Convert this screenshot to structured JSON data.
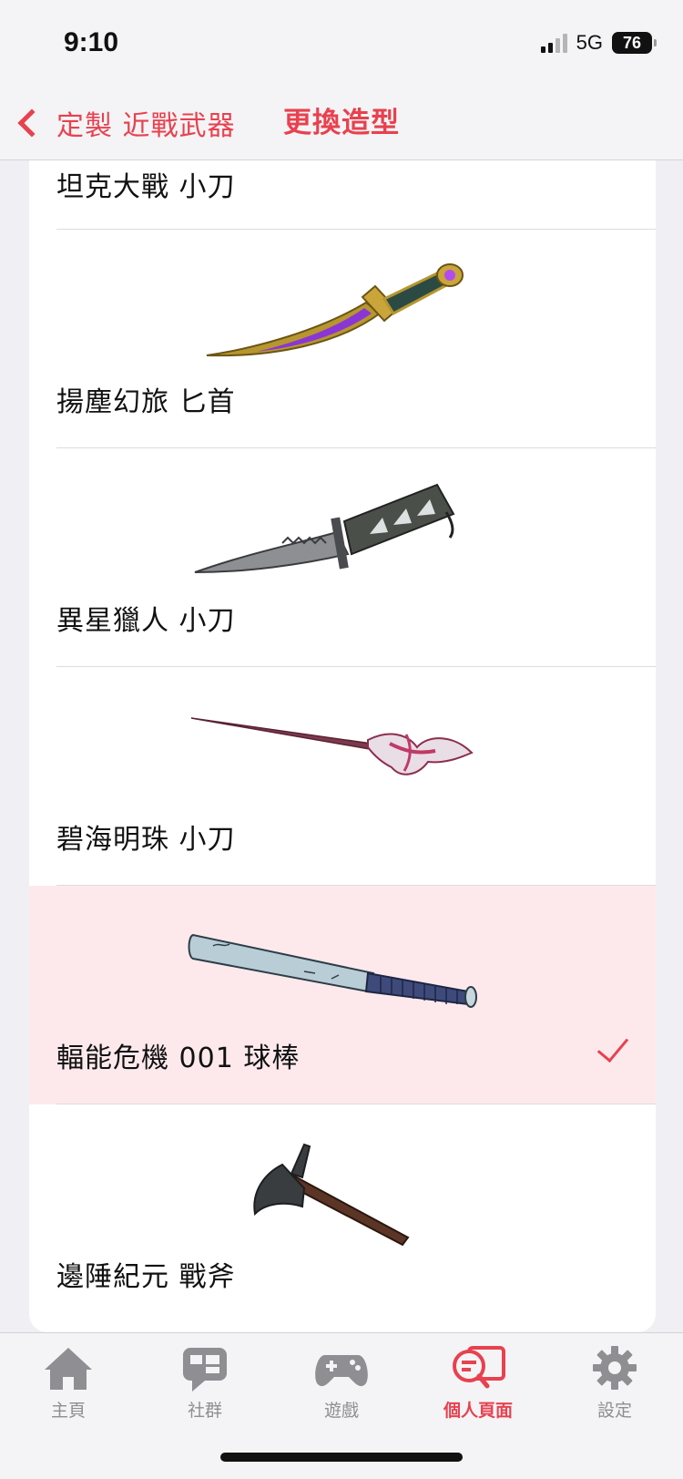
{
  "status_bar": {
    "time": "9:10",
    "network": "5G",
    "battery": "76"
  },
  "nav": {
    "back_label": "定製 近戰武器",
    "title": "更換造型"
  },
  "list": {
    "items": [
      {
        "name": "坦克大戰 小刀",
        "selected": false
      },
      {
        "name": "揚塵幻旅 匕首",
        "selected": false
      },
      {
        "name": "異星獵人 小刀",
        "selected": false
      },
      {
        "name": "碧海明珠 小刀",
        "selected": false
      },
      {
        "name": "輻能危機 001 球棒",
        "selected": true
      },
      {
        "name": "邊陲紀元 戰斧",
        "selected": false
      }
    ]
  },
  "tabs": [
    {
      "label": "主頁",
      "icon": "home-icon",
      "active": false
    },
    {
      "label": "社群",
      "icon": "chat-bubble-icon",
      "active": false
    },
    {
      "label": "遊戲",
      "icon": "gamepad-icon",
      "active": false
    },
    {
      "label": "個人頁面",
      "icon": "profile-search-icon",
      "active": true
    },
    {
      "label": "設定",
      "icon": "gear-icon",
      "active": false
    }
  ],
  "colors": {
    "accent": "#e8414f",
    "selected_row": "#fde9ec",
    "tab_inactive": "#8e8e93"
  }
}
